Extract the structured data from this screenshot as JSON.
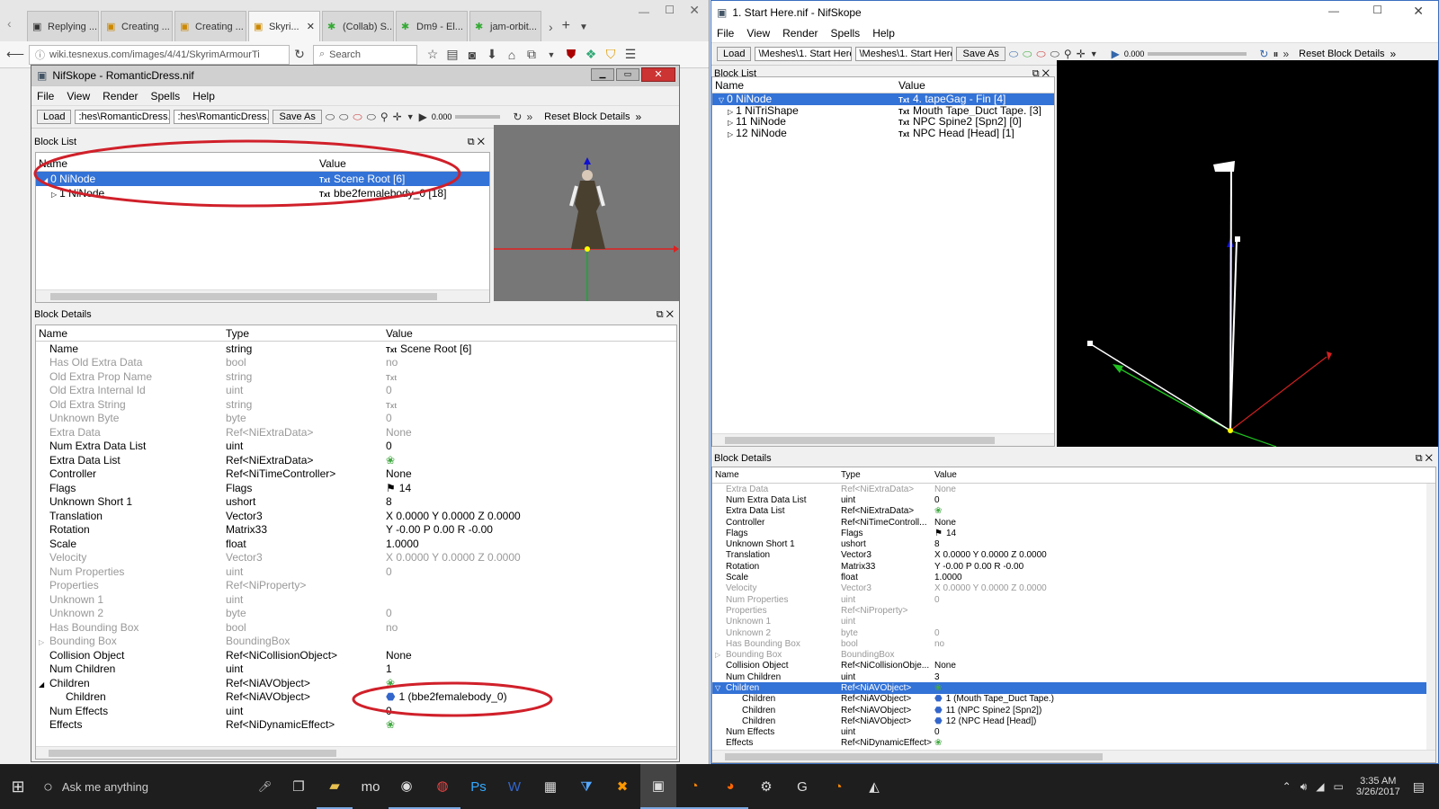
{
  "browser": {
    "tabs": [
      {
        "title": "Replying ...",
        "icon": "forum-icon"
      },
      {
        "title": "Creating ...",
        "icon": "page-icon"
      },
      {
        "title": "Creating ...",
        "icon": "page-icon"
      },
      {
        "title": "Skyri...",
        "icon": "page-icon"
      },
      {
        "title": "(Collab) S...",
        "icon": "nexus-icon"
      },
      {
        "title": "Dm9 - El...",
        "icon": "nexus-icon"
      },
      {
        "title": "jam-orbit...",
        "icon": "nexus-icon"
      }
    ],
    "url": "wiki.tesnexus.com/images/4/41/SkyrimArmourTi",
    "search_placeholder": "Search"
  },
  "left_win": {
    "title": "NifSkope - RomanticDress.nif",
    "menu": [
      "File",
      "View",
      "Render",
      "Spells",
      "Help"
    ],
    "load": "Load",
    "input1": ":hes\\RomanticDress.nif",
    "input2": ":hes\\RomanticDress.nif",
    "save_as": "Save As",
    "time": "0.000",
    "reset": "Reset Block Details",
    "block_list_title": "Block List",
    "col_name": "Name",
    "col_value": "Value",
    "block_rows": [
      {
        "name": "0 NiNode",
        "value": "Scene Root [6]"
      },
      {
        "name": "1 NiNode",
        "value": "bbe2femalebody_0 [18]"
      }
    ],
    "block_details_title": "Block Details",
    "col_type": "Type",
    "details": [
      {
        "name": "Name",
        "type": "string",
        "value": "Scene Root [6]",
        "mark": "Txt"
      },
      {
        "name": "Has Old Extra Data",
        "type": "bool",
        "value": "no",
        "dim": true
      },
      {
        "name": "Old Extra Prop Name",
        "type": "string",
        "value": "",
        "mark": "Txt",
        "dim": true
      },
      {
        "name": "Old Extra Internal Id",
        "type": "uint",
        "value": "0",
        "dim": true
      },
      {
        "name": "Old Extra String",
        "type": "string",
        "value": "",
        "mark": "Txt",
        "dim": true
      },
      {
        "name": "Unknown Byte",
        "type": "byte",
        "value": "0",
        "dim": true
      },
      {
        "name": "Extra Data",
        "type": "Ref<NiExtraData>",
        "value": "None",
        "dim": true
      },
      {
        "name": "Num Extra Data List",
        "type": "uint",
        "value": "0"
      },
      {
        "name": "Extra Data List",
        "type": "Ref<NiExtraData>",
        "value": "",
        "mark": "link"
      },
      {
        "name": "Controller",
        "type": "Ref<NiTimeController>",
        "value": "None"
      },
      {
        "name": "Flags",
        "type": "Flags",
        "value": "14",
        "mark": "flag"
      },
      {
        "name": "Unknown Short 1",
        "type": "ushort",
        "value": "8"
      },
      {
        "name": "Translation",
        "type": "Vector3",
        "value": "X 0.0000 Y 0.0000 Z 0.0000"
      },
      {
        "name": "Rotation",
        "type": "Matrix33",
        "value": "Y -0.00 P 0.00 R -0.00"
      },
      {
        "name": "Scale",
        "type": "float",
        "value": "1.0000"
      },
      {
        "name": "Velocity",
        "type": "Vector3",
        "value": "X 0.0000 Y 0.0000 Z 0.0000",
        "dim": true
      },
      {
        "name": "Num Properties",
        "type": "uint",
        "value": "0",
        "dim": true
      },
      {
        "name": "Properties",
        "type": "Ref<NiProperty>",
        "value": "",
        "dim": true
      },
      {
        "name": "Unknown 1",
        "type": "uint",
        "value": "",
        "dim": true
      },
      {
        "name": "Unknown 2",
        "type": "byte",
        "value": "0",
        "dim": true
      },
      {
        "name": "Has Bounding Box",
        "type": "bool",
        "value": "no",
        "dim": true
      },
      {
        "name": "Bounding Box",
        "type": "BoundingBox",
        "value": "",
        "dim": true,
        "expand": "▷"
      },
      {
        "name": "Collision Object",
        "type": "Ref<NiCollisionObject>",
        "value": "None"
      },
      {
        "name": "Num Children",
        "type": "uint",
        "value": "1"
      },
      {
        "name": "Children",
        "type": "Ref<NiAVObject>",
        "value": "",
        "mark": "link",
        "expand": "◢"
      },
      {
        "name": "Children",
        "type": "Ref<NiAVObject>",
        "value": "1 (bbe2femalebody_0)",
        "mark": "node",
        "indent": true
      },
      {
        "name": "Num Effects",
        "type": "uint",
        "value": "0"
      },
      {
        "name": "Effects",
        "type": "Ref<NiDynamicEffect>",
        "value": "",
        "mark": "link"
      }
    ]
  },
  "right_win": {
    "title": "1. Start Here.nif - NifSkope",
    "menu": [
      "File",
      "View",
      "Render",
      "Spells",
      "Help"
    ],
    "load": "Load",
    "input1": "\\Meshes\\1. Start Here.nif",
    "input2": "\\Meshes\\1. Start Here.nif",
    "save_as": "Save As",
    "time": "0.000",
    "reset": "Reset Block Details",
    "block_list_title": "Block List",
    "col_name": "Name",
    "col_value": "Value",
    "block_rows": [
      {
        "name": "0 NiNode",
        "value": "4. tapeGag - Fin [4]",
        "sel": true,
        "expand": "▽"
      },
      {
        "name": "1 NiTriShape",
        "value": "Mouth Tape_Duct Tape. [3]",
        "expand": "▷",
        "indent": true
      },
      {
        "name": "11 NiNode",
        "value": "NPC Spine2 [Spn2] [0]",
        "indent": true
      },
      {
        "name": "12 NiNode",
        "value": "NPC Head [Head] [1]",
        "indent": true
      }
    ],
    "block_details_title": "Block Details",
    "col_type": "Type",
    "details": [
      {
        "name": "Extra Data",
        "type": "Ref<NiExtraData>",
        "value": "None",
        "dim": true
      },
      {
        "name": "Num Extra Data List",
        "type": "uint",
        "value": "0"
      },
      {
        "name": "Extra Data List",
        "type": "Ref<NiExtraData>",
        "value": "",
        "mark": "link"
      },
      {
        "name": "Controller",
        "type": "Ref<NiTimeControll...",
        "value": "None"
      },
      {
        "name": "Flags",
        "type": "Flags",
        "value": "14",
        "mark": "flag"
      },
      {
        "name": "Unknown Short 1",
        "type": "ushort",
        "value": "8"
      },
      {
        "name": "Translation",
        "type": "Vector3",
        "value": "X 0.0000 Y 0.0000 Z 0.0000"
      },
      {
        "name": "Rotation",
        "type": "Matrix33",
        "value": "Y -0.00 P 0.00 R -0.00"
      },
      {
        "name": "Scale",
        "type": "float",
        "value": "1.0000"
      },
      {
        "name": "Velocity",
        "type": "Vector3",
        "value": "X 0.0000 Y 0.0000 Z 0.0000",
        "dim": true
      },
      {
        "name": "Num Properties",
        "type": "uint",
        "value": "0",
        "dim": true
      },
      {
        "name": "Properties",
        "type": "Ref<NiProperty>",
        "value": "",
        "dim": true
      },
      {
        "name": "Unknown 1",
        "type": "uint",
        "value": "",
        "dim": true
      },
      {
        "name": "Unknown 2",
        "type": "byte",
        "value": "0",
        "dim": true
      },
      {
        "name": "Has Bounding Box",
        "type": "bool",
        "value": "no",
        "dim": true
      },
      {
        "name": "Bounding Box",
        "type": "BoundingBox",
        "value": "",
        "dim": true,
        "expand": "▷"
      },
      {
        "name": "Collision Object",
        "type": "Ref<NiCollisionObje...",
        "value": "None"
      },
      {
        "name": "Num Children",
        "type": "uint",
        "value": "3"
      },
      {
        "name": "Children",
        "type": "Ref<NiAVObject>",
        "value": "",
        "mark": "link",
        "sel": true,
        "expand": "▽"
      },
      {
        "name": "Children",
        "type": "Ref<NiAVObject>",
        "value": "1 (Mouth Tape_Duct Tape.)",
        "mark": "node",
        "indent": true
      },
      {
        "name": "Children",
        "type": "Ref<NiAVObject>",
        "value": "11 (NPC Spine2 [Spn2])",
        "mark": "node",
        "indent": true
      },
      {
        "name": "Children",
        "type": "Ref<NiAVObject>",
        "value": "12 (NPC Head [Head])",
        "mark": "node",
        "indent": true
      },
      {
        "name": "Num Effects",
        "type": "uint",
        "value": "0"
      },
      {
        "name": "Effects",
        "type": "Ref<NiDynamicEffect>",
        "value": "",
        "mark": "link"
      }
    ]
  },
  "taskbar": {
    "search": "Ask me anything",
    "time": "3:35 AM",
    "date": "3/26/2017"
  },
  "colors": {
    "selection": "#3372d6",
    "annotation": "#d0202a",
    "taskbar": "#1e1e1e"
  }
}
